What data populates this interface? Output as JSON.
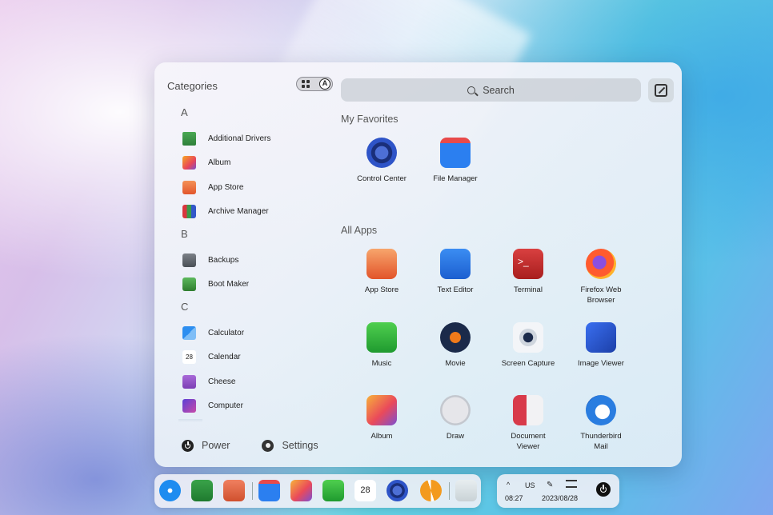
{
  "launcher": {
    "categories_label": "Categories",
    "view_toggle": {
      "grid_icon": "grid-view-icon",
      "alpha_icon": "letter-a-icon",
      "alpha_letter": "A"
    },
    "search": {
      "placeholder": "Search"
    },
    "sections": {
      "favorites": "My Favorites",
      "all_apps": "All Apps"
    },
    "favorites": [
      {
        "label": "Control Center",
        "icon": "control-center-icon"
      },
      {
        "label": "File Manager",
        "icon": "file-manager-icon"
      }
    ],
    "all_apps": [
      {
        "label": "App Store",
        "icon": "app-store-icon"
      },
      {
        "label": "Text Editor",
        "icon": "text-editor-icon"
      },
      {
        "label": "Terminal",
        "icon": "terminal-icon"
      },
      {
        "label": "Firefox Web\nBrowser",
        "icon": "firefox-icon"
      },
      {
        "label": "Music",
        "icon": "music-icon"
      },
      {
        "label": "Movie",
        "icon": "movie-icon"
      },
      {
        "label": "Screen Capture",
        "icon": "screen-capture-icon"
      },
      {
        "label": "Image Viewer",
        "icon": "image-viewer-icon"
      },
      {
        "label": "Album",
        "icon": "album-icon"
      },
      {
        "label": "Draw",
        "icon": "draw-icon"
      },
      {
        "label": "Document\nViewer",
        "icon": "document-viewer-icon"
      },
      {
        "label": "Thunderbird\nMail",
        "icon": "thunderbird-icon"
      }
    ],
    "category_groups": [
      {
        "letter": "A",
        "items": [
          "Additional Drivers",
          "Album",
          "App Store",
          "Archive Manager"
        ]
      },
      {
        "letter": "B",
        "items": [
          "Backups",
          "Boot Maker"
        ]
      },
      {
        "letter": "C",
        "items": [
          "Calculator",
          "Calendar",
          "Cheese",
          "Computer"
        ]
      }
    ],
    "footer": {
      "power": "Power",
      "settings": "Settings"
    }
  },
  "dock": {
    "apps": [
      "launcher-icon",
      "multitask-view-icon",
      "workspace-icon",
      "file-manager-icon",
      "album-icon",
      "music-icon",
      "calendar-icon",
      "control-center-icon",
      "update-icon",
      "trash-icon"
    ],
    "calendar_day": "28"
  },
  "tray": {
    "keyboard_layout": "US",
    "time": "08:27",
    "date": "2023/08/28",
    "caret": "^"
  },
  "colors": {
    "accent": "#1e8cf0",
    "panel": "#f2f2f7"
  }
}
